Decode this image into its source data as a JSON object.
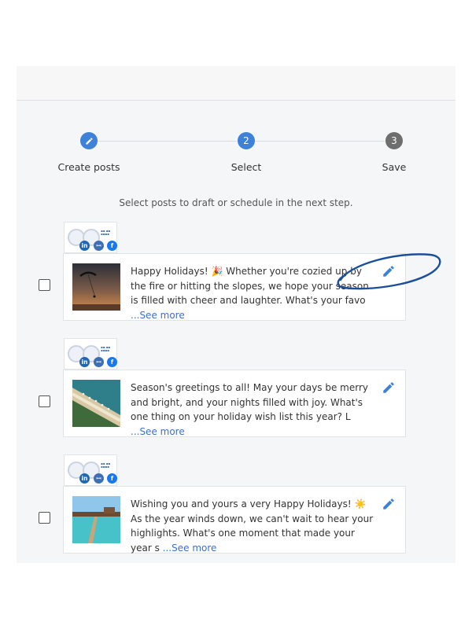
{
  "stepper": {
    "steps": [
      {
        "number": "",
        "label": "Create posts",
        "state": "completed",
        "icon": "pencil-icon"
      },
      {
        "number": "2",
        "label": "Select",
        "state": "active"
      },
      {
        "number": "3",
        "label": "Save",
        "state": "upcoming"
      }
    ]
  },
  "instruction": "Select posts to draft or schedule in the next step.",
  "colors": {
    "accent": "#3d82d8",
    "upcoming": "#6e6e6e",
    "linkedin": "#1f66b5",
    "facebook": "#1877f2",
    "annotation": "#1b4e9b"
  },
  "posts": [
    {
      "checked": false,
      "networks": [
        "linkedin-icon",
        "people-icon",
        "facebook-icon"
      ],
      "badges": {
        "linkedin": "in",
        "people": "ꟷ",
        "facebook": "f"
      },
      "text": "Happy Holidays! 🎉 Whether you're cozied up by the fire or hitting the slopes, we hope your season is filled with cheer and laughter. What's your favo",
      "see_more": "...See more",
      "image": "paraglider-sunset-photo"
    },
    {
      "checked": false,
      "networks": [
        "linkedin-icon",
        "people-icon",
        "facebook-icon"
      ],
      "badges": {
        "linkedin": "in",
        "people": "ꟷ",
        "facebook": "f"
      },
      "text": "Season's greetings to all! May your days be merry and bright, and your nights filled with joy. What's one thing on your holiday wish list this year? L",
      "see_more": "...See more",
      "image": "beach-resort-aerial-photo"
    },
    {
      "checked": false,
      "networks": [
        "linkedin-icon",
        "people-icon",
        "facebook-icon"
      ],
      "badges": {
        "linkedin": "in",
        "people": "ꟷ",
        "facebook": "f"
      },
      "text": "Wishing you and yours a very Happy Holidays! ☀️ As the year winds down, we can't wait to hear your highlights. What's one moment that made your year s",
      "see_more": "...See more",
      "image": "overwater-pier-photo"
    }
  ]
}
